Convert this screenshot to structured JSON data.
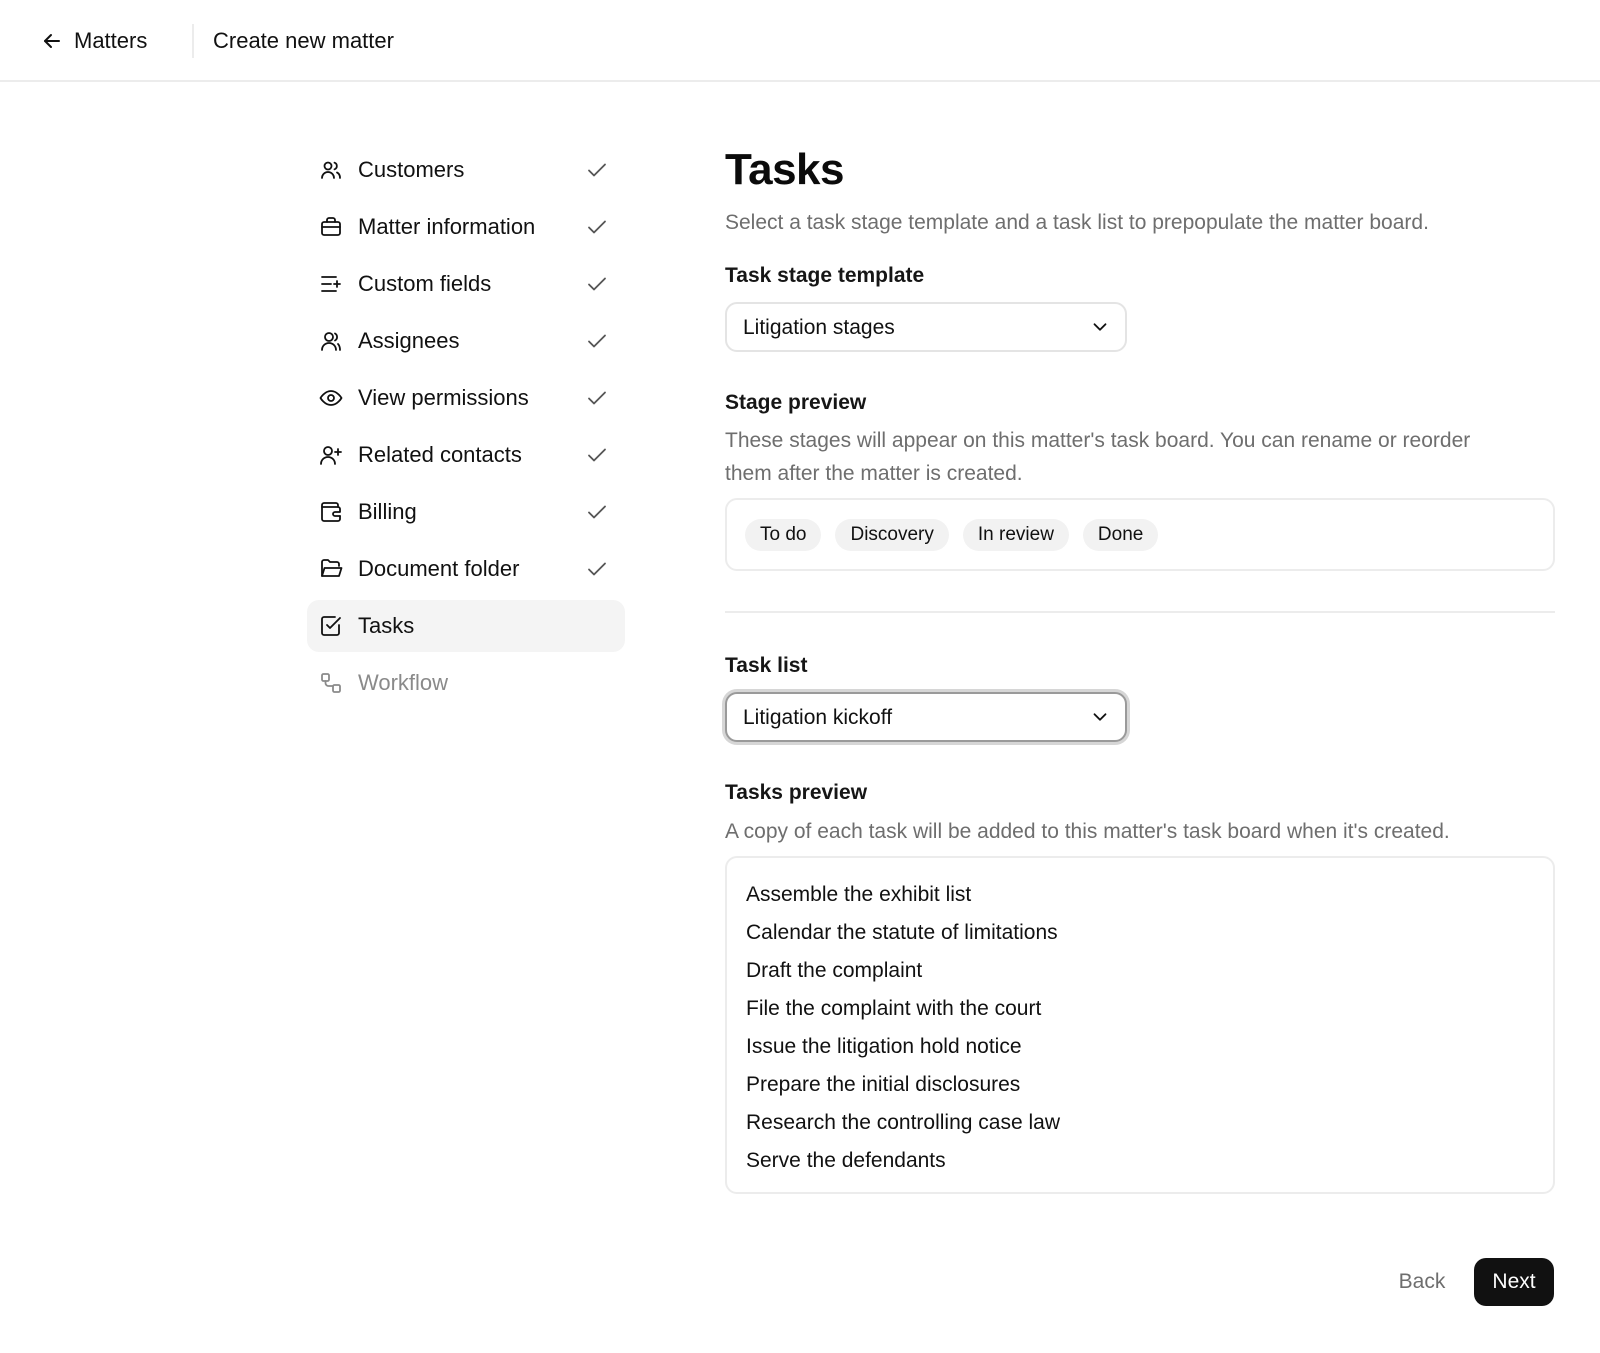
{
  "header": {
    "back_label": "Matters",
    "title": "Create new matter"
  },
  "steps": [
    {
      "label": "Customers",
      "icon": "users-icon",
      "status": "complete"
    },
    {
      "label": "Matter information",
      "icon": "briefcase-icon",
      "status": "complete"
    },
    {
      "label": "Custom fields",
      "icon": "list-plus-icon",
      "status": "complete"
    },
    {
      "label": "Assignees",
      "icon": "user-icon",
      "status": "complete"
    },
    {
      "label": "View permissions",
      "icon": "eye-icon",
      "status": "complete"
    },
    {
      "label": "Related contacts",
      "icon": "user-plus-icon",
      "status": "complete"
    },
    {
      "label": "Billing",
      "icon": "wallet-icon",
      "status": "complete"
    },
    {
      "label": "Document folder",
      "icon": "folder-icon",
      "status": "complete"
    },
    {
      "label": "Tasks",
      "icon": "checkbox-icon",
      "status": "active"
    },
    {
      "label": "Workflow",
      "icon": "workflow-icon",
      "status": "upcoming"
    }
  ],
  "main": {
    "title": "Tasks",
    "subtitle": "Select a task stage template and a task list to prepopulate the matter board.",
    "stage_template": {
      "label": "Task stage template",
      "value": "Litigation stages"
    },
    "stage_preview": {
      "label": "Stage preview",
      "help_line1": "These stages will appear on this matter's task board. You can rename or reorder",
      "help_line2": "them after the matter is created.",
      "stages": [
        "To do",
        "Discovery",
        "In review",
        "Done"
      ]
    },
    "task_list": {
      "label": "Task list",
      "value": "Litigation kickoff"
    },
    "tasks_preview": {
      "label": "Tasks preview",
      "help": "A copy of each task will be added to this matter's task board when it's created.",
      "tasks": [
        "Assemble the exhibit list",
        "Calendar the statute of limitations",
        "Draft the complaint",
        "File the complaint with the court",
        "Issue the litigation hold notice",
        "Prepare the initial disclosures",
        "Research the controlling case law",
        "Serve the defendants"
      ]
    }
  },
  "footer": {
    "back_label": "Back",
    "next_label": "Next"
  },
  "colors": {
    "primary_button": "#111111",
    "active_step_bg": "#f4f4f4",
    "muted_text": "#6e6e6e",
    "border": "#ececec"
  }
}
